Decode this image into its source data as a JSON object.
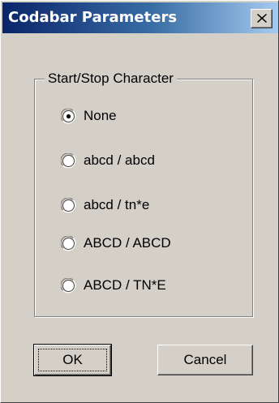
{
  "dialog": {
    "title": "Codabar Parameters",
    "close_icon": "close-icon"
  },
  "start_stop_group": {
    "label": "Start/Stop Character",
    "options": [
      {
        "label": "None",
        "selected": true
      },
      {
        "label": "abcd / abcd",
        "selected": false
      },
      {
        "label": "abcd / tn*e",
        "selected": false
      },
      {
        "label": "ABCD / ABCD",
        "selected": false
      },
      {
        "label": "ABCD / TN*E",
        "selected": false
      }
    ]
  },
  "buttons": {
    "ok_label": "OK",
    "cancel_label": "Cancel"
  },
  "colors": {
    "face": "#d4d0c8",
    "title_active_start": "#0a246a",
    "title_active_end": "#a6caf0",
    "title_text": "#ffffff"
  }
}
